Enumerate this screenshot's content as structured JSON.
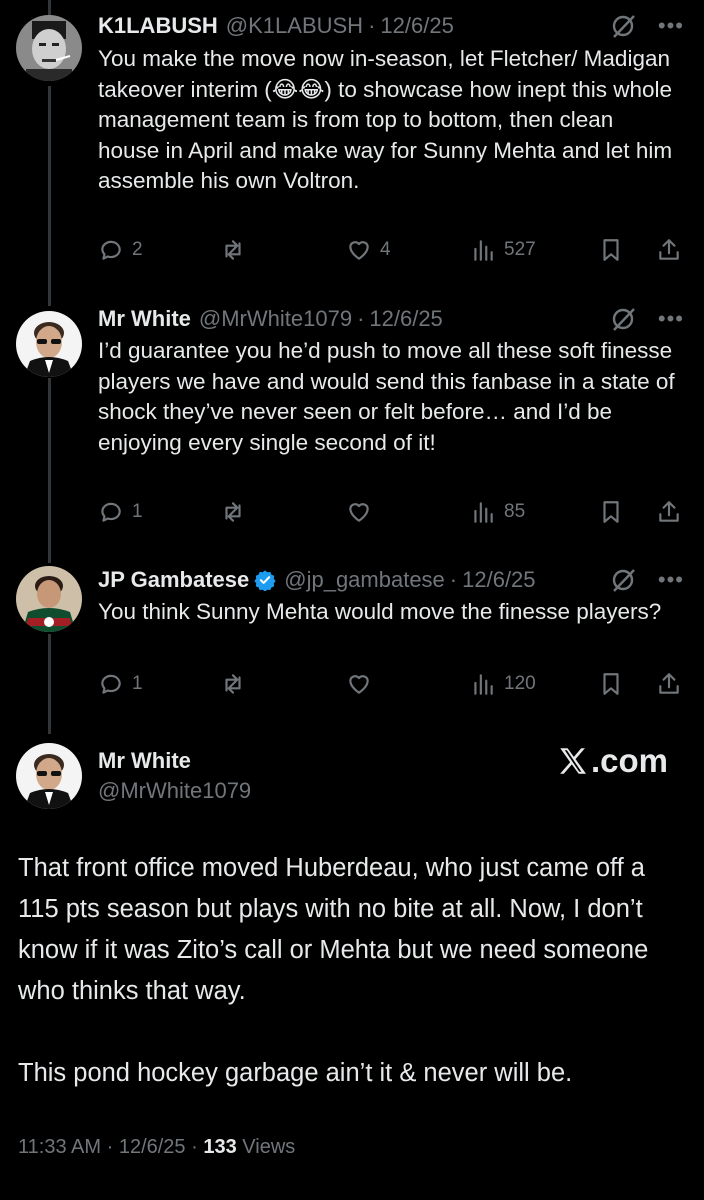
{
  "tweets": [
    {
      "name": "K1LABUSH",
      "handle": "@K1LABUSH",
      "date": "12/6/25",
      "text": "You make the move now in-season, let Fletcher/ Madigan takeover interim (😂😂) to showcase how inept this whole management team is from top to bottom, then clean house in April and make way for Sunny Mehta and let him assemble his own Voltron.",
      "replies": "2",
      "reposts": "",
      "likes": "4",
      "views": "527"
    },
    {
      "name": "Mr White",
      "handle": "@MrWhite1079",
      "date": "12/6/25",
      "text": "I’d guarantee you he’d push to move all these soft finesse players we have and would send this fanbase in a state of shock they’ve never seen or felt before… and I’d be enjoying every single second of it!",
      "replies": "1",
      "reposts": "",
      "likes": "",
      "views": "85"
    },
    {
      "name": "JP Gambatese",
      "handle": "@jp_gambatese",
      "date": "12/6/25",
      "text": "You think Sunny Mehta would move the finesse players?",
      "replies": "1",
      "reposts": "",
      "likes": "",
      "views": "120",
      "verified": true
    }
  ],
  "main": {
    "name": "Mr White",
    "handle": "@MrWhite1079",
    "brand": ".com",
    "paragraph1": "That front office moved Huberdeau, who just came off a 115 pts season but plays with no bite at all. Now, I don’t know if it was Zito’s call or Mehta but we need someone who thinks that way.",
    "paragraph2": "This pond hockey garbage ain’t it & never will be.",
    "time": "11:33 AM",
    "date": "12/6/25",
    "views_count": "133",
    "views_label": "Views"
  },
  "separator": "·",
  "colors": {
    "background": "#000000",
    "text": "#e7e9ea",
    "muted": "#71767b",
    "verified": "#1d9bf0"
  },
  "icons": [
    "reply-icon",
    "repost-icon",
    "like-icon",
    "views-icon",
    "bookmark-icon",
    "share-icon",
    "grok-icon",
    "more-icon",
    "verified-badge-icon",
    "x-logo-icon"
  ]
}
